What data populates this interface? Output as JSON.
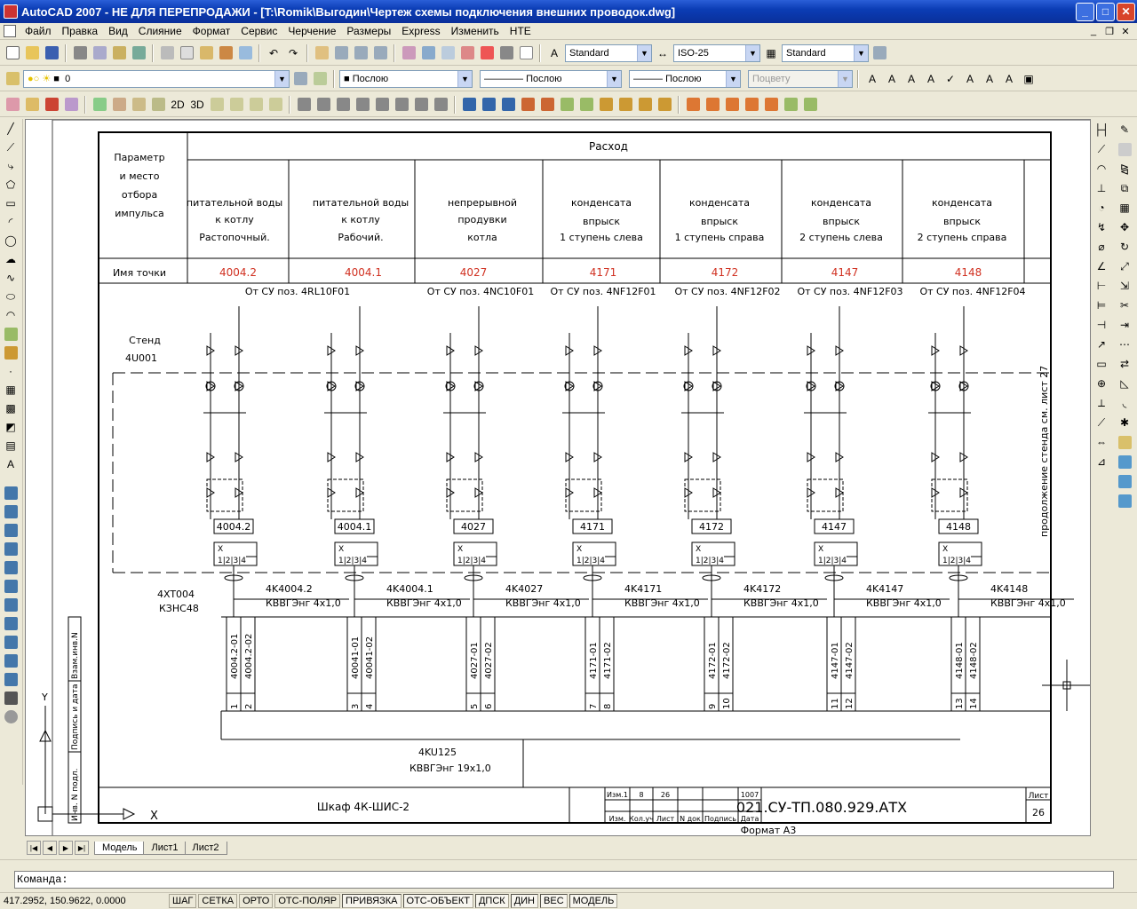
{
  "window": {
    "title": "AutoCAD 2007 - НЕ ДЛЯ ПЕРЕПРОДАЖИ - [T:\\Romik\\Выгодин\\Чертеж схемы подключения внешних проводок.dwg]"
  },
  "menu": {
    "items": [
      "Файл",
      "Правка",
      "Вид",
      "Слияние",
      "Формат",
      "Сервис",
      "Черчение",
      "Размеры",
      "Express",
      "Изменить",
      "НТЕ"
    ]
  },
  "styles": {
    "text_style": "Standard",
    "dim_style": "ISO-25",
    "table_style": "Standard"
  },
  "layers": {
    "current": "0",
    "color": "Послою",
    "linetype": "Послою",
    "lineweight": "Послою",
    "plotstyle": "Поцвету"
  },
  "drawing": {
    "header": {
      "param": [
        "Параметр",
        "и место",
        "отбора",
        "импульса"
      ],
      "rashod": "Расход",
      "point_name": "Имя точки"
    },
    "columns": [
      {
        "lines": [
          "питательной воды",
          "к котлу",
          "Растопочный."
        ],
        "point": "4004.2"
      },
      {
        "lines": [
          "питательной воды",
          "к котлу",
          "Рабочий."
        ],
        "point": "4004.1"
      },
      {
        "lines": [
          "непрерывной",
          "продувки",
          "котла"
        ],
        "point": "4027"
      },
      {
        "lines": [
          "конденсата",
          "впрыск",
          "1 ступень слева"
        ],
        "point": "4171"
      },
      {
        "lines": [
          "конденсата",
          "впрыск",
          "1 ступень справа"
        ],
        "point": "4172"
      },
      {
        "lines": [
          "конденсата",
          "впрыск",
          "2 ступень слева"
        ],
        "point": "4147"
      },
      {
        "lines": [
          "конденсата",
          "впрыск",
          "2 ступень справа"
        ],
        "point": "4148"
      }
    ],
    "sources": [
      "От СУ поз. 4RL10F01",
      "От СУ поз. 4NC10F01",
      "От СУ поз. 4NF12F01",
      "От СУ поз. 4NF12F02",
      "От СУ поз. 4NF12F03",
      "От СУ поз. 4NF12F04"
    ],
    "stand": {
      "label": "Стенд",
      "id": "4U001"
    },
    "transmitters": [
      "4004.2",
      "4004.1",
      "4027",
      "4171",
      "4172",
      "4147",
      "4148"
    ],
    "cables": [
      {
        "name": "4K4004.2",
        "type": "КВВГЭнг 4х1,0",
        "w1": "4004.2-01",
        "w2": "4004.2-02",
        "t1": "1",
        "t2": "2"
      },
      {
        "name": "4K4004.1",
        "type": "КВВГЭнг 4х1,0",
        "w1": "40041-01",
        "w2": "40041-02",
        "t1": "3",
        "t2": "4"
      },
      {
        "name": "4K4027",
        "type": "КВВГЭнг 4х1,0",
        "w1": "4027-01",
        "w2": "4027-02",
        "t1": "5",
        "t2": "6"
      },
      {
        "name": "4K4171",
        "type": "КВВГЭнг 4х1,0",
        "w1": "4171-01",
        "w2": "4171-02",
        "t1": "7",
        "t2": "8"
      },
      {
        "name": "4K4172",
        "type": "КВВГЭнг 4х1,0",
        "w1": "4172-01",
        "w2": "4172-02",
        "t1": "9",
        "t2": "10"
      },
      {
        "name": "4K4147",
        "type": "КВВГЭнг 4х1,0",
        "w1": "4147-01",
        "w2": "4147-02",
        "t1": "11",
        "t2": "12"
      },
      {
        "name": "4K4148",
        "type": "КВВГЭнг 4х1,0",
        "w1": "4148-01",
        "w2": "4148-02",
        "t1": "13",
        "t2": "14"
      }
    ],
    "xt": {
      "name": "4XT004",
      "type": "КЗНС48"
    },
    "main_cable": {
      "name": "4KU125",
      "type": "КВВГЭнг 19х1,0"
    },
    "cabinet": "Шкаф 4К-ШИС-2",
    "continuation": "продолжение стенда см. лист 27",
    "stamp": {
      "code": "021.СУ-ТП.080.929.АТХ",
      "sheet_label": "Лист",
      "sheet": "26",
      "format": "Формат А3",
      "row1": [
        "Изм.1",
        "8",
        "26",
        "",
        "",
        "1007"
      ],
      "row2": [
        "Изм.",
        "Кол.уч",
        "Лист",
        "N док",
        "Подпись",
        "Дата"
      ]
    },
    "side_labels": [
      "Инв. N подл.",
      "Подпись и дата",
      "Взам.инв.N"
    ]
  },
  "layout_tabs": [
    "Модель",
    "Лист1",
    "Лист2"
  ],
  "command": {
    "prompt": "Команда:"
  },
  "status": {
    "coords": "417.2952, 150.9622, 0.0000",
    "buttons": [
      "ШАГ",
      "СЕТКА",
      "ОРТО",
      "ОТС-ПОЛЯР",
      "ПРИВЯЗКА",
      "ОТС-ОБЪЕКТ",
      "ДПСК",
      "ДИН",
      "ВЕС",
      "МОДЕЛЬ"
    ],
    "active": [
      "ПРИВЯЗКА",
      "ОТС-ОБЪЕКТ",
      "ДПСК",
      "ДИН",
      "ВЕС",
      "МОДЕЛЬ"
    ]
  },
  "colors": {
    "title_bar": "#0a3db5",
    "point_text": "#d03020",
    "drawing_line": "#000000"
  }
}
